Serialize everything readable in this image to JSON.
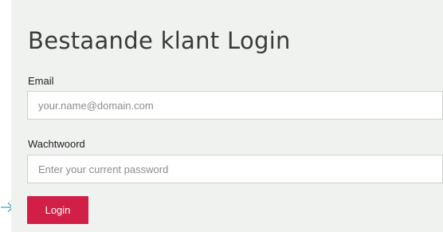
{
  "login_form": {
    "title": "Bestaande klant Login",
    "email_label": "Email",
    "email_value": "",
    "email_placeholder": "your.name@domain.com",
    "password_label": "Wachtwoord",
    "password_value": "",
    "password_placeholder": "Enter your current password",
    "submit_label": "Login"
  },
  "pointer": {
    "icon": "arrow-right-icon",
    "color": "#3aa6c8"
  },
  "colors": {
    "accent": "#d21f47",
    "panel_background": "#f0f2f0"
  }
}
